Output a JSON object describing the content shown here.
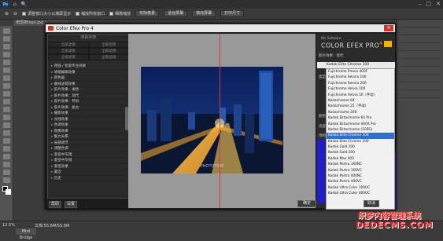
{
  "photoshop": {
    "app_label": "Ps",
    "tab_label": "南国夜Iogo.jpg",
    "options": {
      "resize_windows": "调整窗口大小以满屏显示",
      "zoom_all": "缩放所有窗口",
      "scrubby_zoom": "细微缩放",
      "actual_pixels": "实际像素",
      "fit_screen": "适合屏幕",
      "fill_screen": "填充屏幕",
      "print_size": "打印尺寸"
    },
    "status": {
      "zoom": "12.5%",
      "doc": "文档:55.6M/55.6M",
      "mini_bridge": "Mini Bridge"
    }
  },
  "plugin": {
    "title": "Color Efex Pro 4",
    "brand": "Nik Software",
    "product": "COLOR EFEX PRO",
    "product_version": "4",
    "categories": {
      "header": "类别列表",
      "items": [
        "全部滤镜",
        "全部滤镜",
        "全部滤镜",
        "全部滤镜",
        "全部滤镜",
        "全部滤镜"
      ]
    },
    "filters": [
      "增强 / 智能专业效果",
      "填镜编辑效果",
      "颜色画",
      "曲线滤镜效果",
      "胶片效果：褪色",
      "胶片效果：现代",
      "胶片效果：怀旧",
      "胶片效果：复古",
      "摄影效果",
      "光线效果",
      "色调效果",
      "图像效果",
      "魅力光晕",
      "局部调节",
      "调整色调",
      "渐变中灰镜",
      "渐变中灰镜",
      "渐变效果"
    ],
    "recent_label": "最近",
    "history_label": "历史",
    "help_button": "帮助",
    "settings_button": "设置",
    "ok_button": "确定",
    "cancel_button": "取消",
    "panel_labels": {
      "fx": "胶片效果：现代",
      "type": "类型",
      "strength": "颜色",
      "brightness": "亮度",
      "saturation": "饱和度"
    },
    "dropdown_selected": "Kodak Elite Chrome 100",
    "film_list": [
      "Fujichrome Provia 400F",
      "Fujichrome Sensia 100",
      "Fujichrome Sensia 200",
      "Fujichrome Velvia 100",
      "Fujichrome Velvia 50（手动）",
      "Kodachrome 64",
      "Kodachrome 25（手动）",
      "Kodachrome 200",
      "Kodak Ektachrome 64 Pro",
      "Kodak Ektachrome 400X Pro",
      "Kodak Ektachrome (100G)",
      "Kodak Elite Chrome 100",
      "Kodak Elite Chrome 200",
      "Kodak Gold 100",
      "Kodak Gold 200",
      "Kodak Max 400",
      "Kodak Portra 160NC",
      "Kodak Portra 160VC",
      "Kodak Portra 400NC",
      "Kodak Portra 400VC",
      "Kodak Ultra Color 100UC",
      "Kodak Ultra Color 400UC"
    ],
    "selected_film_index": 11,
    "preview_watermark": "PHOTOTIME"
  },
  "watermark": {
    "line1": "织梦内容管理系统",
    "line2": "DEDECMS.COM"
  },
  "colors": {
    "split_line": "#d2384a",
    "selection": "#2e6fd0",
    "accent_blue": "#1e1ec9"
  }
}
